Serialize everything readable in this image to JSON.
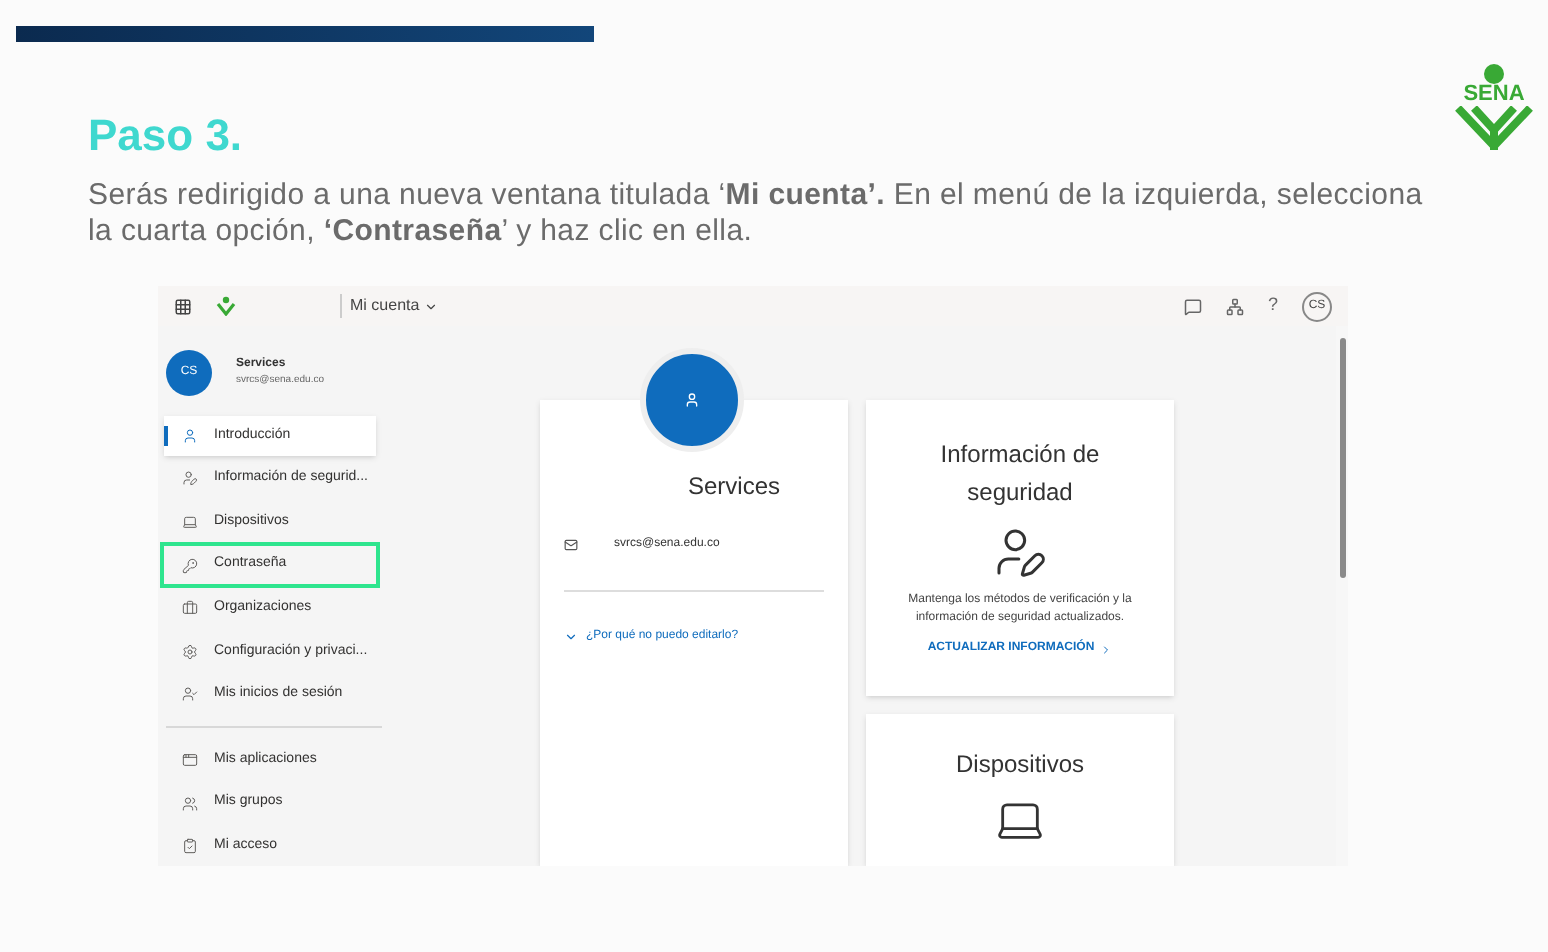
{
  "slide": {
    "title": "Paso 3.",
    "instruction": "Serás redirigido a una nueva ventana titulada ‘**Mi cuenta’.** En el menú de la izquierda, selecciona la cuarta opción, **‘Contraseña**’ y haz clic en ella.",
    "logo": "SENA"
  },
  "screenshot": {
    "top_bar": {
      "app_title": "Mi cuenta",
      "avatar": "CS",
      "help": "?"
    },
    "profile": {
      "initials": "CS",
      "name": "Services",
      "email": "svrcs@sena.edu.co"
    },
    "sidebar": {
      "items": [
        {
          "kind": "intro",
          "label": "Introducción",
          "selected": true,
          "highlighted": false
        },
        {
          "kind": "security",
          "label": "Información de segurid...",
          "selected": false,
          "highlighted": false
        },
        {
          "kind": "devices",
          "label": "Dispositivos",
          "selected": false,
          "highlighted": false
        },
        {
          "kind": "password",
          "label": "Contraseña",
          "selected": false,
          "highlighted": true
        },
        {
          "kind": "orgs",
          "label": "Organizaciones",
          "selected": false,
          "highlighted": false
        },
        {
          "kind": "settings",
          "label": "Configuración y privaci...",
          "selected": false,
          "highlighted": false
        },
        {
          "kind": "signins",
          "label": "Mis inicios de sesión",
          "selected": false,
          "highlighted": false
        },
        {
          "kind": "divider"
        },
        {
          "kind": "apps",
          "label": "Mis aplicaciones",
          "selected": false,
          "highlighted": false
        },
        {
          "kind": "groups",
          "label": "Mis grupos",
          "selected": false,
          "highlighted": false
        },
        {
          "kind": "access",
          "label": "Mi acceso",
          "selected": false,
          "highlighted": false
        }
      ]
    },
    "profile_card": {
      "name": "Services",
      "email": "svrcs@sena.edu.co",
      "link": "¿Por qué no puedo editarlo?"
    },
    "security_card": {
      "title": "Información de seguridad",
      "description": "Mantenga los métodos de verificación y la información de seguridad actualizados.",
      "link": "ACTUALIZAR INFORMACIÓN"
    },
    "devices_card": {
      "title": "Dispositivos"
    }
  }
}
